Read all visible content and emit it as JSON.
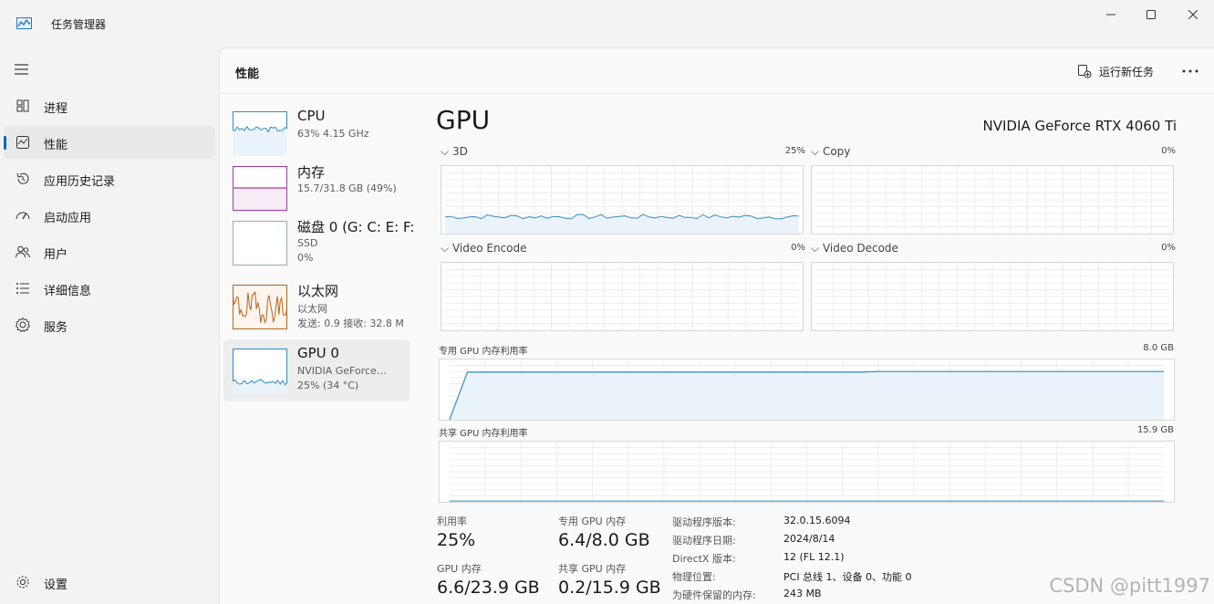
{
  "app": {
    "title": "任务管理器"
  },
  "nav": {
    "items": [
      {
        "label": "进程"
      },
      {
        "label": "性能"
      },
      {
        "label": "应用历史记录"
      },
      {
        "label": "启动应用"
      },
      {
        "label": "用户"
      },
      {
        "label": "详细信息"
      },
      {
        "label": "服务"
      }
    ],
    "settings": "设置",
    "active": "性能"
  },
  "header": {
    "title": "性能",
    "run_task": "运行新任务"
  },
  "devices": [
    {
      "name": "CPU",
      "line1": "63%  4.15 GHz",
      "line2": ""
    },
    {
      "name": "内存",
      "line1": "15.7/31.8 GB (49%)",
      "line2": ""
    },
    {
      "name": "磁盘 0 (G: C: E: F:",
      "line1": "SSD",
      "line2": "0%"
    },
    {
      "name": "以太网",
      "line1": "以太网",
      "line2": "发送: 0.9  接收: 32.8 M"
    },
    {
      "name": "GPU 0",
      "line1": "NVIDIA GeForce…",
      "line2": "25% (34 °C)"
    }
  ],
  "gpu": {
    "title": "GPU",
    "model": "NVIDIA GeForce RTX 4060 Ti",
    "engines": [
      {
        "name": "3D",
        "percent": "25%",
        "level": 0.25
      },
      {
        "name": "Copy",
        "percent": "0%",
        "level": 0
      },
      {
        "name": "Video Encode",
        "percent": "0%",
        "level": 0
      },
      {
        "name": "Video Decode",
        "percent": "0%",
        "level": 0
      }
    ],
    "dedicated_mem": {
      "label": "专用 GPU 内存利用率",
      "max": "8.0 GB",
      "level": 0.8
    },
    "shared_mem": {
      "label": "共享 GPU 内存利用率",
      "max": "15.9 GB",
      "level": 0.013
    }
  },
  "stats": {
    "utilization": {
      "label": "利用率",
      "value": "25%"
    },
    "dedicated": {
      "label": "专用 GPU 内存",
      "value": "6.4/8.0 GB"
    },
    "gpu_mem": {
      "label": "GPU 内存",
      "value": "6.6/23.9 GB"
    },
    "shared": {
      "label": "共享 GPU 内存",
      "value": "0.2/15.9 GB"
    }
  },
  "props": [
    {
      "label": "驱动程序版本:",
      "value": "32.0.15.6094"
    },
    {
      "label": "驱动程序日期:",
      "value": "2024/8/14"
    },
    {
      "label": "DirectX 版本:",
      "value": "12 (FL 12.1)"
    },
    {
      "label": "物理位置:",
      "value": "PCI 总线 1、设备 0、功能 0"
    },
    {
      "label": "为硬件保留的内存:",
      "value": "243 MB"
    }
  ],
  "watermark": "CSDN @pitt1997",
  "colors": {
    "gpu_line": "#2f8bc2",
    "gpu_fill": "#eaf3f9",
    "mem_line": "#a23aa7",
    "net_line": "#b5651d",
    "accent": "#0067c0"
  }
}
